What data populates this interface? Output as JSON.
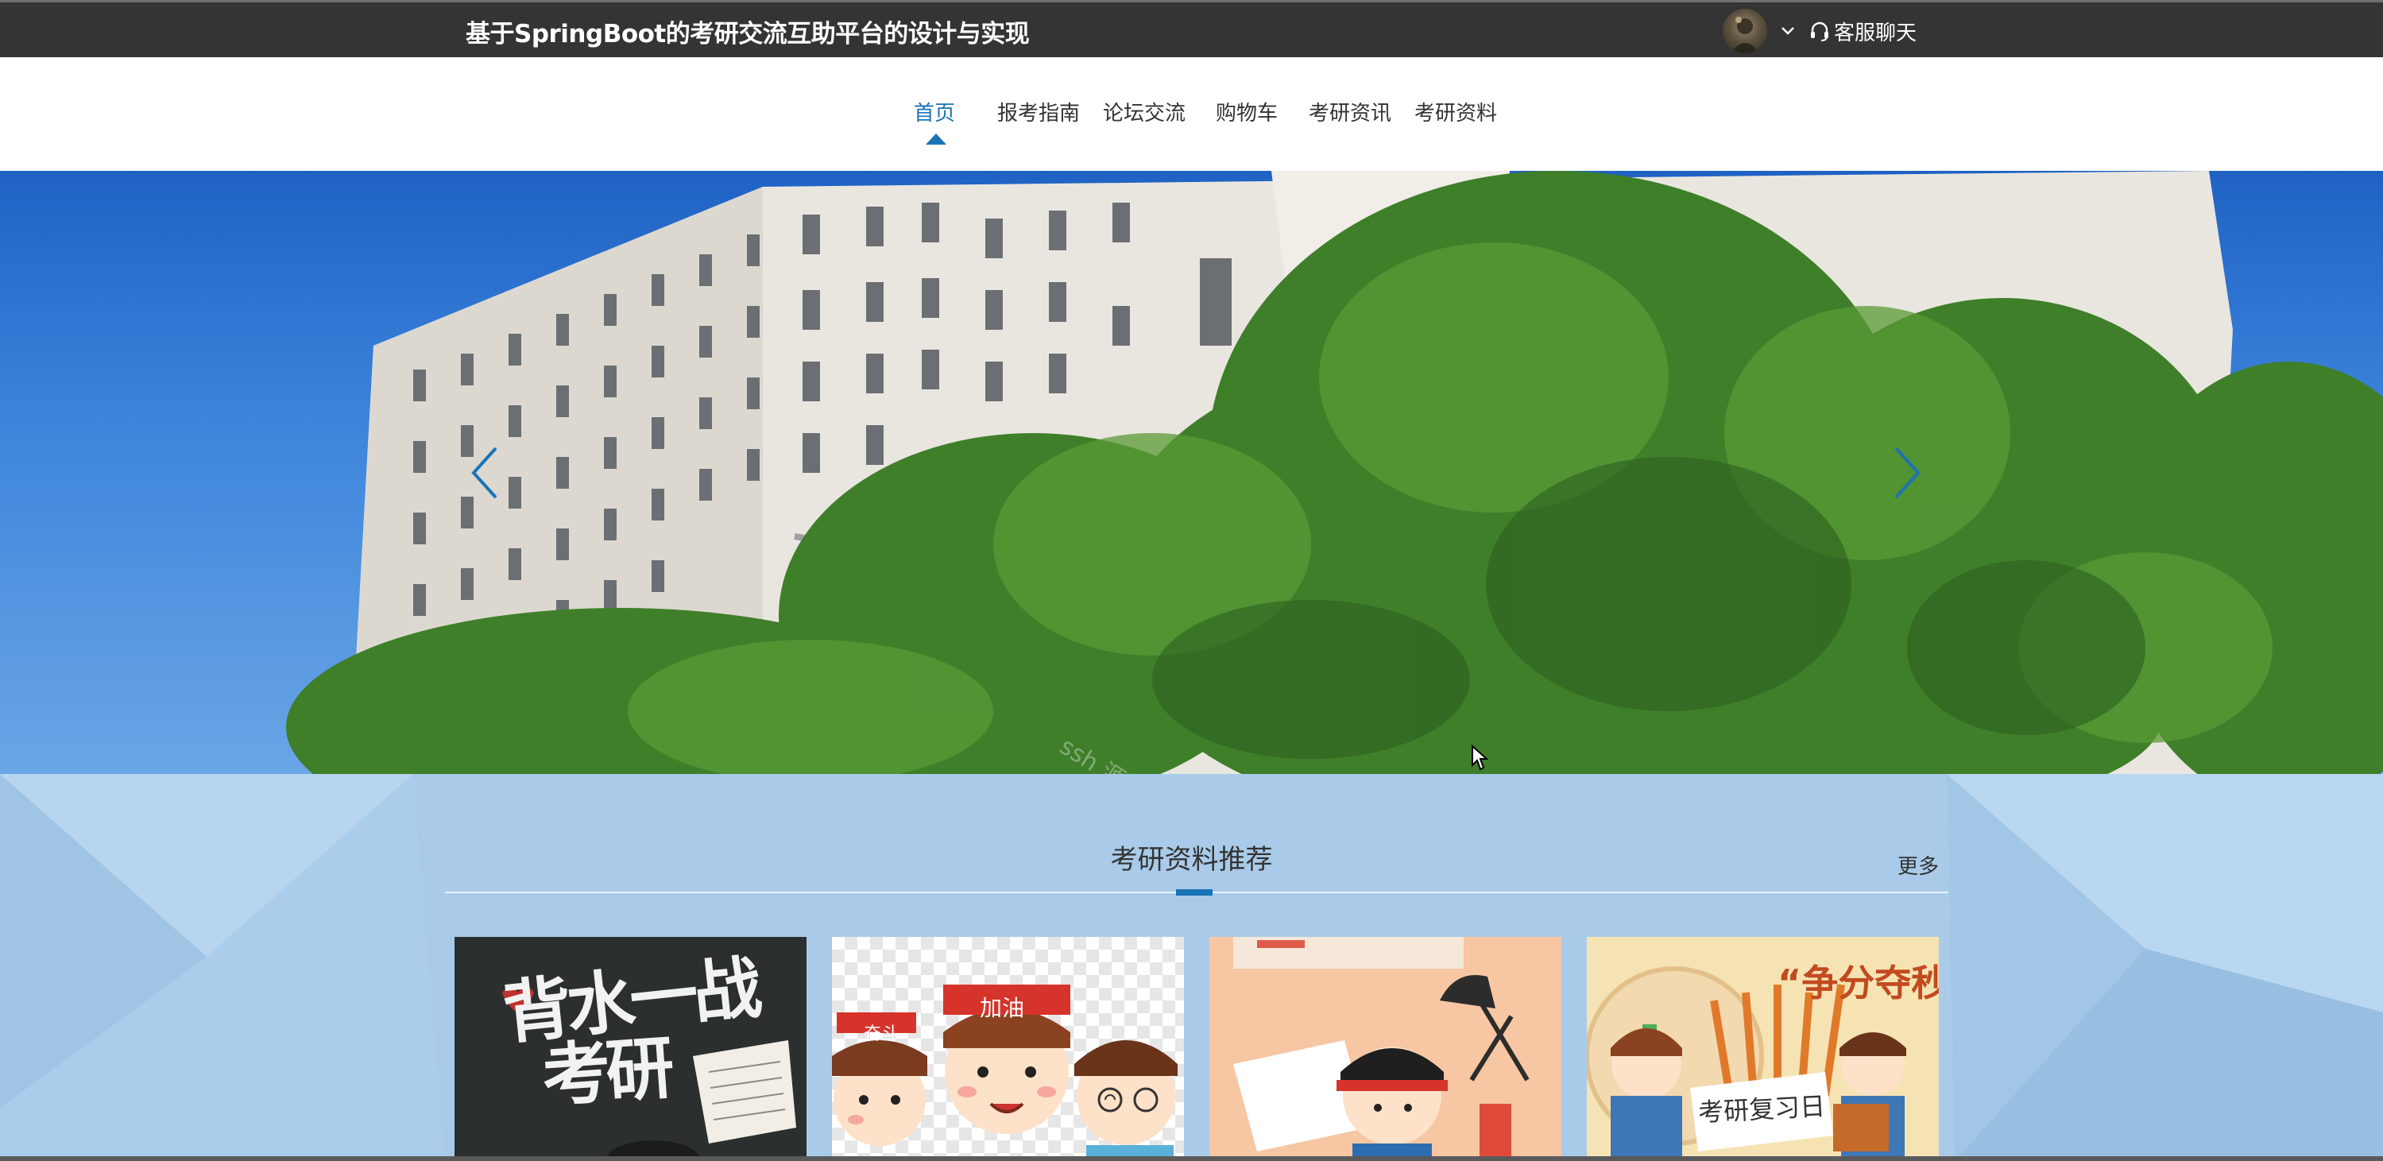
{
  "header": {
    "title": "基于SpringBoot的考研交流互助平台的设计与实现",
    "service_label": "客服聊天"
  },
  "nav": {
    "items": [
      {
        "label": "首页",
        "active": true
      },
      {
        "label": "报考指南",
        "active": false
      },
      {
        "label": "论坛交流",
        "active": false
      },
      {
        "label": "购物车",
        "active": false
      },
      {
        "label": "考研资讯",
        "active": false
      },
      {
        "label": "考研资料",
        "active": false
      }
    ]
  },
  "banner": {
    "watermark": "ssh 源码学优会"
  },
  "recommend": {
    "title": "考研资料推荐",
    "more_label": "更多",
    "cards": [
      {
        "texts": [
          "背水一战",
          "考研"
        ]
      },
      {
        "texts": [
          "奋斗",
          "加油"
        ]
      },
      {
        "texts": []
      },
      {
        "texts": [
          "“争分夺秒",
          "考研复习日"
        ]
      }
    ]
  },
  "colors": {
    "topbar": "#343434",
    "accent": "#1a73b7",
    "section_bg": "#a9cbe9"
  },
  "icons": [
    "avatar",
    "chevron-down-icon",
    "headset-icon",
    "chevron-left-icon",
    "chevron-right-icon",
    "mouse-cursor-icon"
  ]
}
